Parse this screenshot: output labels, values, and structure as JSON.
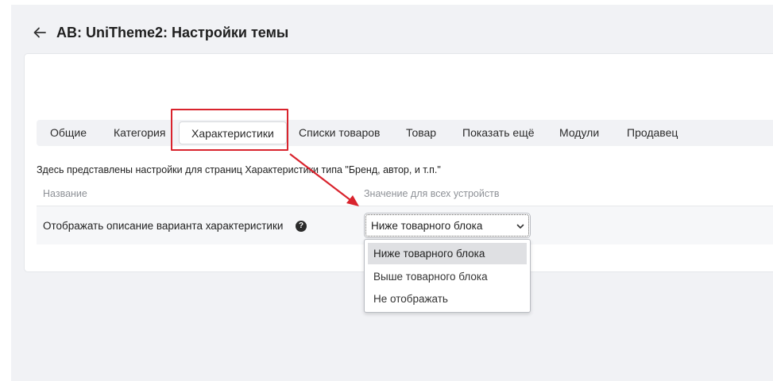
{
  "header": {
    "title": "AB: UniTheme2: Настройки темы"
  },
  "tabs": [
    {
      "label": "Общие"
    },
    {
      "label": "Категория"
    },
    {
      "label": "Характеристики"
    },
    {
      "label": "Списки товаров"
    },
    {
      "label": "Товар"
    },
    {
      "label": "Показать ещё"
    },
    {
      "label": "Модули"
    },
    {
      "label": "Продавец"
    }
  ],
  "active_tab": "Характеристики",
  "section": {
    "description": "Здесь представлены настройки для страниц Характеристики типа \"Бренд, автор, и т.п.\"",
    "col_name": "Название",
    "col_value": "Значение для всех устройств"
  },
  "setting": {
    "label": "Отображать описание варианта характеристики",
    "help_icon": "?",
    "selected": "Ниже товарного блока",
    "options": [
      "Ниже товарного блока",
      "Выше товарного блока",
      "Не отображать"
    ]
  },
  "colors": {
    "annotation": "#d9232d",
    "page_bg": "#f1f2f5"
  }
}
